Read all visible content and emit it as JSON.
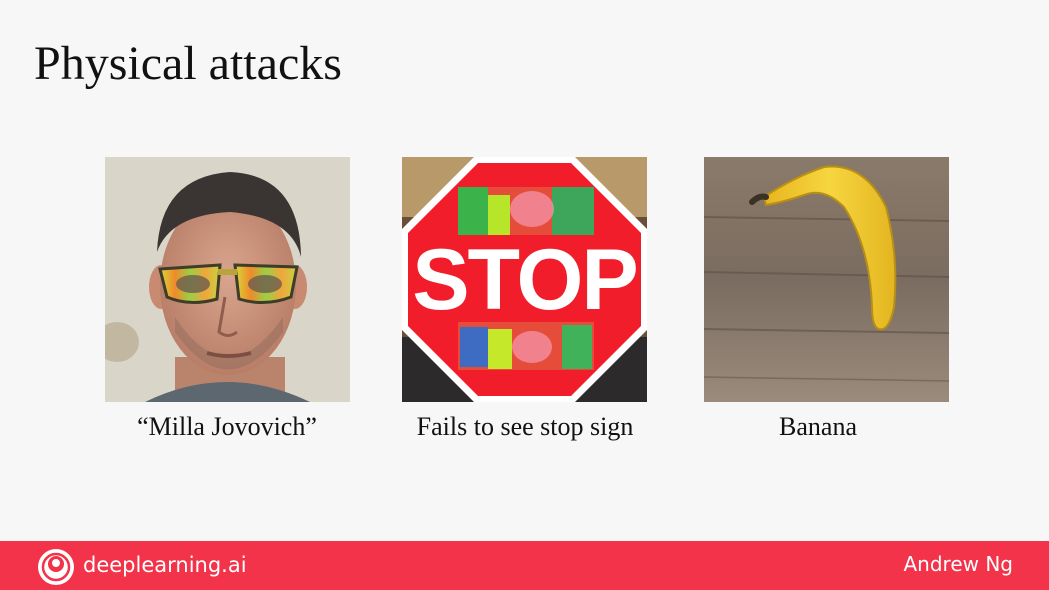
{
  "slide": {
    "title": "Physical attacks"
  },
  "examples": [
    {
      "caption": "“Milla Jovovich”"
    },
    {
      "caption": "Fails to see stop sign",
      "sign_text": "STOP"
    },
    {
      "caption": "Banana"
    }
  ],
  "footer": {
    "brand": "deeplearning.ai",
    "author": "Andrew Ng"
  },
  "colors": {
    "footer_bar": "#f2334a",
    "stop_red": "#f11d2b",
    "banana_yellow": "#f2d13a"
  }
}
